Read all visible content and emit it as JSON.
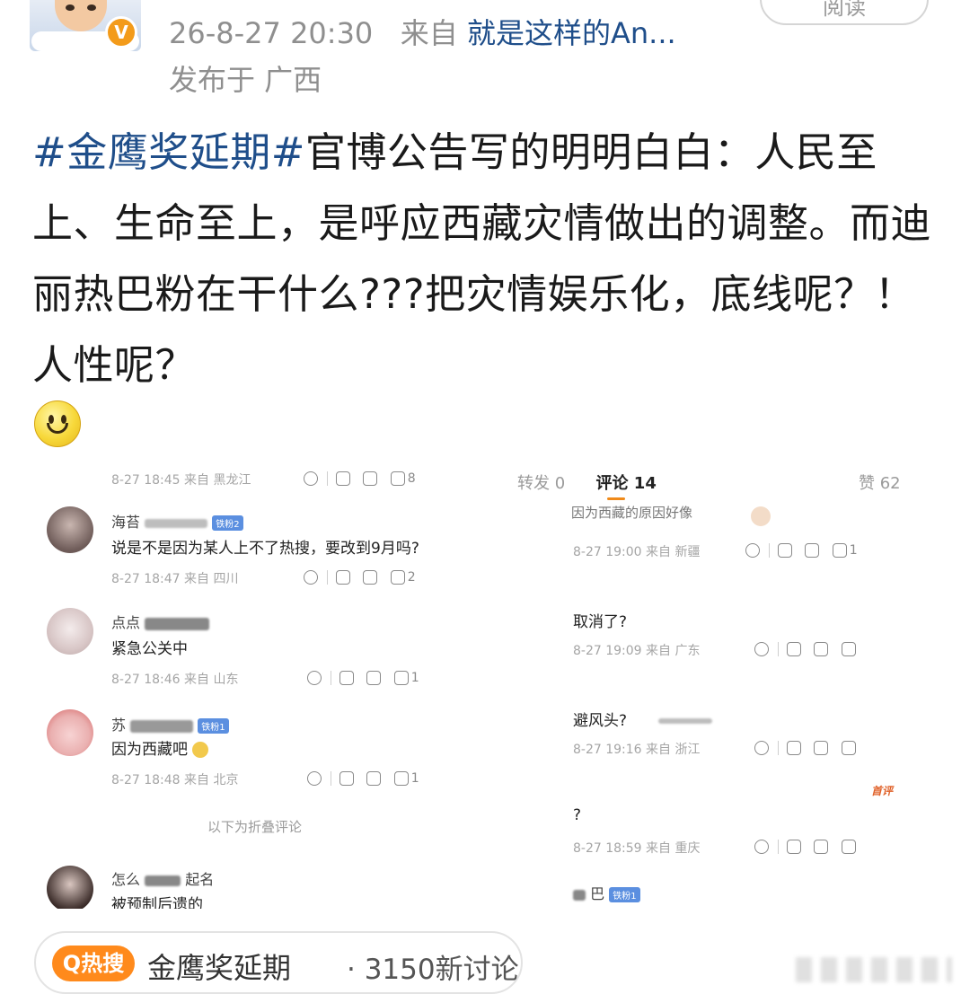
{
  "header": {
    "timestamp": "26-8-27 20:30",
    "source_prefix": "来自",
    "source": "就是这样的An...",
    "location": "发布于 广西",
    "read_button": "阅读",
    "verified_badge": "V"
  },
  "post": {
    "hashtag": "#金鹰奖延期#",
    "text": "官博公告写的明明白白：人民至上、生命至上，是呼应西藏灾情做出的调整。而迪丽热巴粉在干什么???把灾情娱乐化，底线呢？！人性呢？",
    "emoji": "smile-emoji"
  },
  "left_panel": {
    "top_meta": "8-27 18:45 来自 黑龙江",
    "top_like": "8",
    "comments": [
      {
        "name": "海苔",
        "level": "铁粉2",
        "text": "说是不是因为某人上不了热搜，要改到9月吗?",
        "meta": "8-27 18:47 来自 四川",
        "likes": "2"
      },
      {
        "name": "点点",
        "level": "",
        "text": "紧急公关中",
        "meta": "8-27 18:46 来自 山东",
        "likes": "1"
      },
      {
        "name": "苏",
        "level": "铁粉1",
        "text": "因为西藏吧",
        "meta": "8-27 18:48 来自 北京",
        "likes": "1"
      }
    ],
    "fold_label": "以下为折叠评论",
    "last_name": "怎么",
    "last_name_tail": "起名",
    "last_text": "被预制后遗的"
  },
  "right_panel": {
    "tabs": {
      "repost": "转发 0",
      "comment": "评论 14",
      "like": "赞 62"
    },
    "partial_text": "因为西藏的原因好像",
    "comments": [
      {
        "text": "",
        "meta": "8-27 19:00 来自 新疆",
        "likes": "1"
      },
      {
        "text": "取消了?",
        "meta": "8-27 19:09 来自 广东",
        "likes": ""
      },
      {
        "text": "避风头?",
        "meta": "8-27 19:16 来自 浙江",
        "likes": ""
      },
      {
        "text": "?",
        "meta": "8-27 18:59 来自 重庆",
        "likes": ""
      }
    ],
    "first_review_badge": "首评",
    "last_name": "巴",
    "last_level": "铁粉1"
  },
  "topic": {
    "hot_label": "Q热搜",
    "title": "金鹰奖延期",
    "count": "· 3150新讨论"
  },
  "colors": {
    "link": "#1f4e8a",
    "meta": "#8f8f8f",
    "hot": "#ff8a1c"
  }
}
